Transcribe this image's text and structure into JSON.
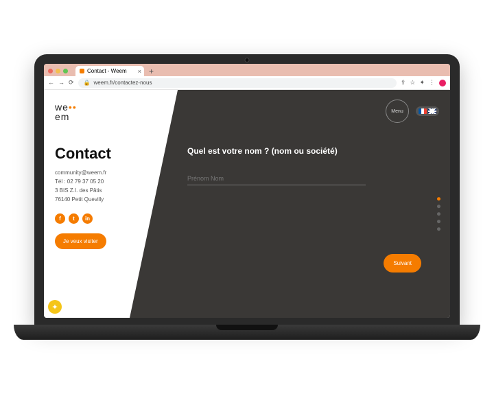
{
  "browser": {
    "tab_title": "Contact - Weem",
    "url": "weem.fr/contactez-nous"
  },
  "header": {
    "menu_label": "Menu"
  },
  "logo": {
    "line1_a": "we",
    "line1_b": "•",
    "line2_a": "•",
    "line2_b": "em"
  },
  "contact": {
    "title": "Contact",
    "email": "community@weem.fr",
    "phone": "Tél : 02 79 37 05 20",
    "address1": "3 BIS Z.I. des Pâtis",
    "address2": "76140 Petit Quevilly",
    "visit_label": "Je veux visiter"
  },
  "socials": {
    "fb": "f",
    "tw": "t",
    "in": "in"
  },
  "form": {
    "question": "Quel est votre nom ? (nom ou société)",
    "placeholder": "Prénom Nom",
    "value": "",
    "next_label": "Suivant"
  },
  "stepper": {
    "total": 5,
    "active": 0
  }
}
